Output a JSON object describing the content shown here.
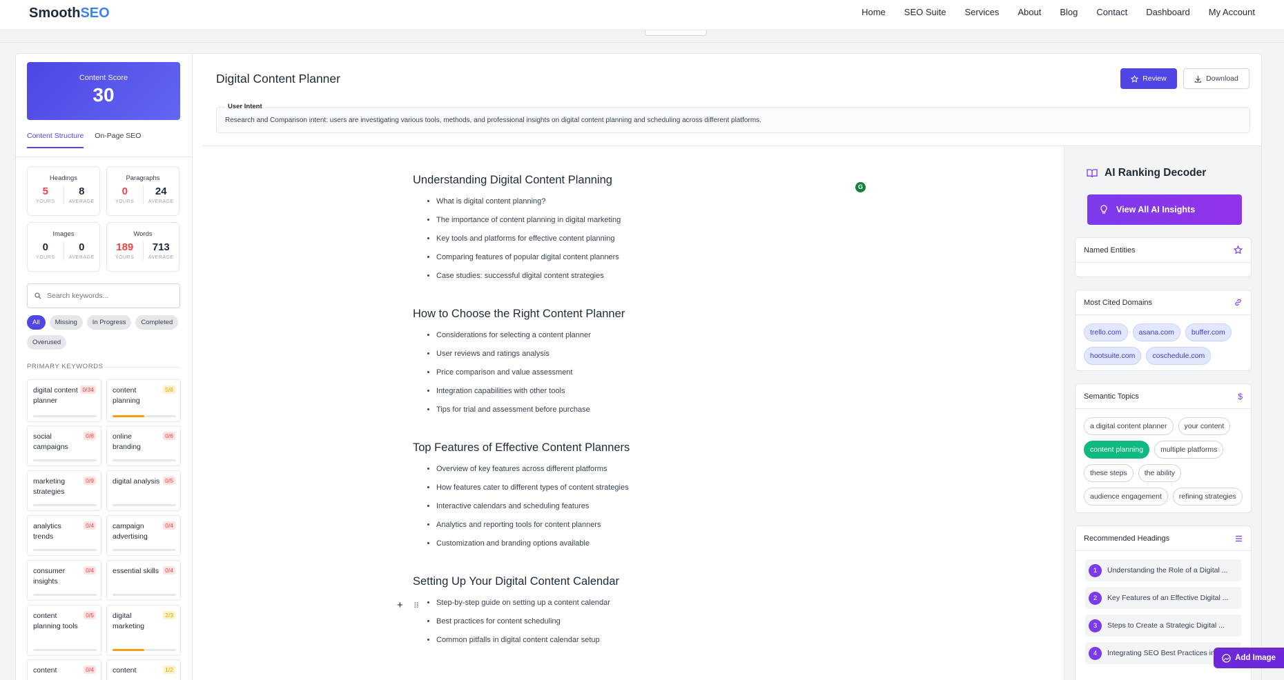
{
  "nav": {
    "logo_part1": "Smooth",
    "logo_part2": "SEO",
    "items": [
      "Home",
      "SEO Suite",
      "Services",
      "About",
      "Blog",
      "Contact",
      "Dashboard",
      "My Account"
    ]
  },
  "sidebar": {
    "score_label": "Content Score",
    "score_value": "30",
    "tabs": [
      "Content Structure",
      "On-Page SEO"
    ],
    "stats": [
      {
        "title": "Headings",
        "yours": "5",
        "average": "8"
      },
      {
        "title": "Paragraphs",
        "yours": "0",
        "average": "24"
      },
      {
        "title": "Images",
        "yours": "0",
        "average": "0"
      },
      {
        "title": "Words",
        "yours": "189",
        "average": "713"
      }
    ],
    "yours_label": "YOURS",
    "average_label": "AVERAGE",
    "search_placeholder": "Search keywords...",
    "filters": [
      "All",
      "Missing",
      "In Progress",
      "Completed",
      "Overused"
    ],
    "primary_keywords_title": "PRIMARY KEYWORDS",
    "keywords": [
      {
        "name": "digital content planner",
        "count": "0/34",
        "progress": 0
      },
      {
        "name": "content planning",
        "count": "5/8",
        "progress": 0.5
      },
      {
        "name": "social campaigns",
        "count": "0/8",
        "progress": 0
      },
      {
        "name": "online branding",
        "count": "0/6",
        "progress": 0
      },
      {
        "name": "marketing strategies",
        "count": "0/9",
        "progress": 0
      },
      {
        "name": "digital analysis",
        "count": "0/5",
        "progress": 0
      },
      {
        "name": "analytics trends",
        "count": "0/4",
        "progress": 0
      },
      {
        "name": "campaign advertising",
        "count": "0/4",
        "progress": 0
      },
      {
        "name": "consumer insights",
        "count": "0/4",
        "progress": 0
      },
      {
        "name": "essential skills",
        "count": "0/4",
        "progress": 0
      },
      {
        "name": "content planning tools",
        "count": "0/5",
        "progress": 0
      },
      {
        "name": "digital marketing",
        "count": "2/3",
        "progress": 0.5
      },
      {
        "name": "content",
        "count": "0/4",
        "progress": 0
      },
      {
        "name": "content",
        "count": "1/2",
        "progress": 0
      }
    ]
  },
  "header": {
    "title": "Digital Content Planner",
    "review_label": "Review",
    "download_label": "Download",
    "intent_label": "User Intent",
    "intent_text": "Research and Comparison intent: users are investigating various tools, methods, and professional insights on digital content planning and scheduling across different platforms."
  },
  "editor": {
    "sections": [
      {
        "heading": "Understanding Digital Content Planning",
        "items": [
          "What is digital content planning?",
          "The importance of content planning in digital marketing",
          "Key tools and platforms for effective content planning",
          "Comparing features of popular digital content planners",
          "Case studies: successful digital content strategies"
        ]
      },
      {
        "heading": "How to Choose the Right Content Planner",
        "items": [
          "Considerations for selecting a content planner",
          "User reviews and ratings analysis",
          "Price comparison and value assessment",
          "Integration capabilities with other tools",
          "Tips for trial and assessment before purchase"
        ]
      },
      {
        "heading": "Top Features of Effective Content Planners",
        "items": [
          "Overview of key features across different platforms",
          "How features cater to different types of content strategies",
          "Interactive calendars and scheduling features",
          "Analytics and reporting tools for content planners",
          "Customization and branding options available"
        ]
      },
      {
        "heading": "Setting Up Your Digital Content Calendar",
        "items": [
          "Step-by-step guide on setting up a content calendar",
          "Best practices for content scheduling",
          "Common pitfalls in digital content calendar setup"
        ]
      }
    ]
  },
  "rpanel": {
    "title": "AI Ranking Decoder",
    "insights_button": "View All AI Insights",
    "named_entities_title": "Named Entities",
    "cited_domains_title": "Most Cited Domains",
    "domains": [
      "trello.com",
      "asana.com",
      "buffer.com",
      "hootsuite.com",
      "coschedule.com"
    ],
    "semantic_title": "Semantic Topics",
    "topics": [
      "a digital content planner",
      "your content",
      "content planning",
      "multiple platforms",
      "these steps",
      "the ability",
      "audience engagement",
      "refining strategies"
    ],
    "highlighted_topic": "content planning",
    "headings_title": "Recommended Headings",
    "headings": [
      {
        "n": "1",
        "text": "Understanding the Role of a Digital ..."
      },
      {
        "n": "2",
        "text": "Key Features of an Effective Digital ..."
      },
      {
        "n": "3",
        "text": "Steps to Create a Strategic Digital ..."
      },
      {
        "n": "4",
        "text": "Integrating SEO Best Practices in Y..."
      }
    ]
  },
  "add_image_label": "Add Image",
  "colors": {
    "primary": "#4f46e5",
    "purple": "#7c3aed",
    "green": "#10b981",
    "red": "#ef4444",
    "amber": "#f59e0b"
  }
}
